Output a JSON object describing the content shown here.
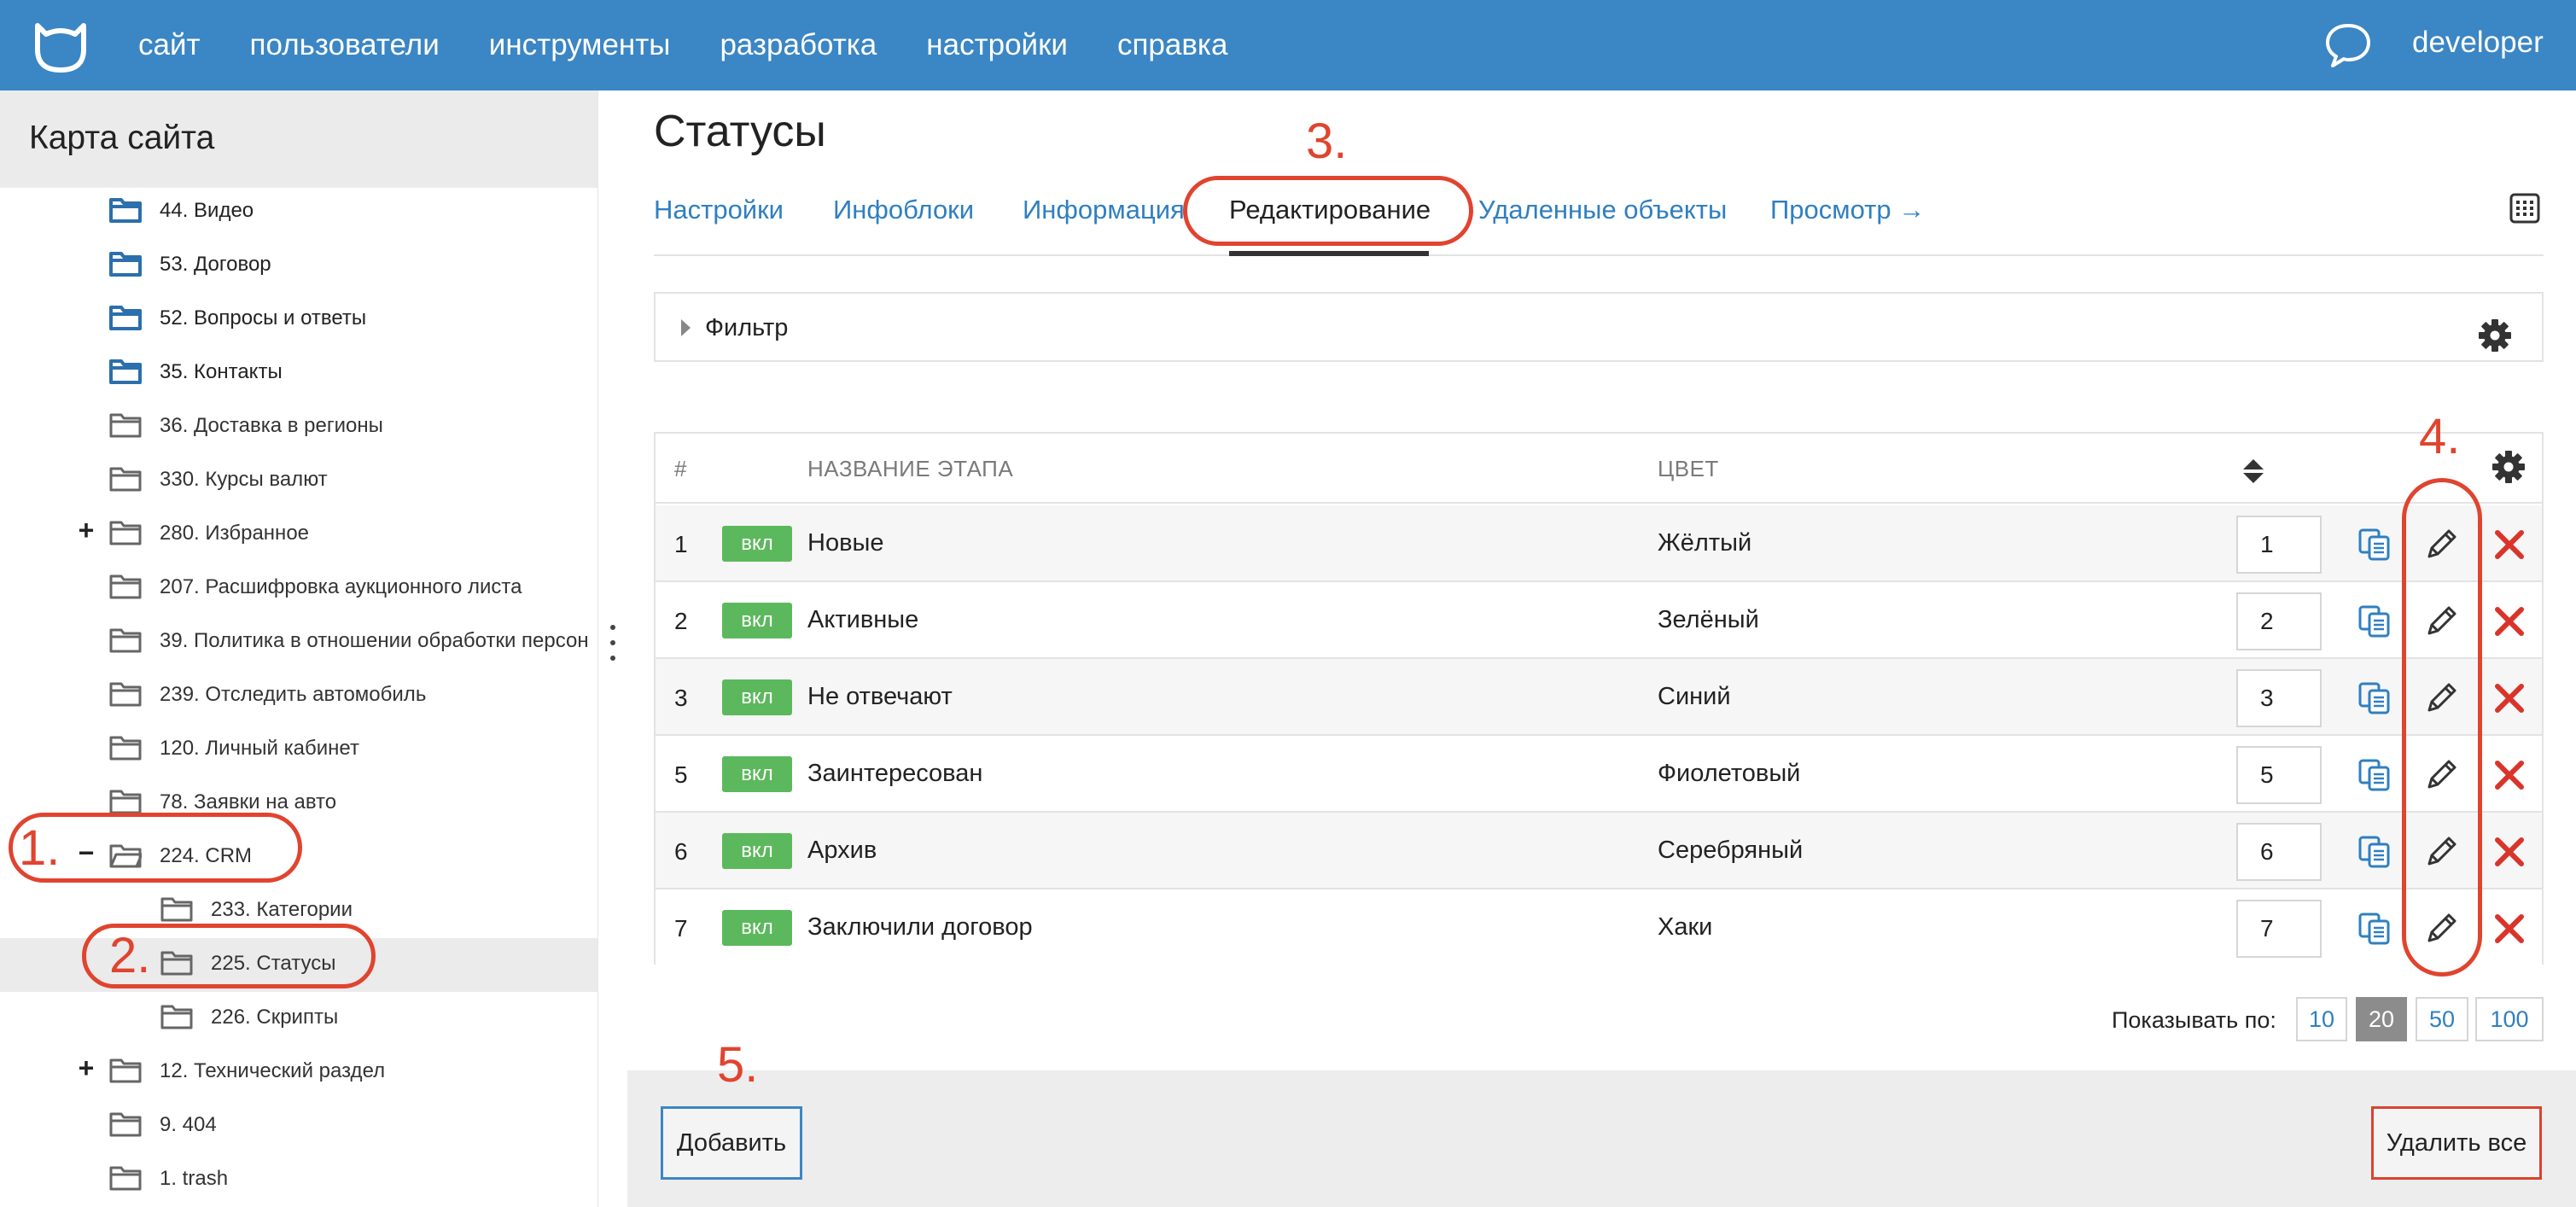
{
  "topbar": {
    "logo_icon": "cat-logo-icon",
    "nav": [
      "сайт",
      "пользователи",
      "инструменты",
      "разработка",
      "настройки",
      "справка"
    ],
    "chat_icon": "chat-bubble-icon",
    "user": "developer",
    "color": "#3b86c4"
  },
  "sidebar": {
    "title": "Карта сайта",
    "items": [
      {
        "label": "44. Видео",
        "toggle": ""
      },
      {
        "label": "53. Договор",
        "toggle": ""
      },
      {
        "label": "52. Вопросы и ответы",
        "toggle": ""
      },
      {
        "label": "35. Контакты",
        "toggle": ""
      },
      {
        "label": "36. Доставка в регионы",
        "toggle": ""
      },
      {
        "label": "330. Курсы валют",
        "toggle": ""
      },
      {
        "label": "280. Избранное",
        "toggle": "+"
      },
      {
        "label": "207. Расшифровка аукционного листа",
        "toggle": ""
      },
      {
        "label": "39. Политика в отношении обработки персон",
        "toggle": ""
      },
      {
        "label": "239. Отследить автомобиль",
        "toggle": ""
      },
      {
        "label": "120. Личный кабинет",
        "toggle": ""
      },
      {
        "label": "78. Заявки на авто",
        "toggle": ""
      },
      {
        "label": "224. CRM",
        "toggle": "−"
      },
      {
        "label": "233. Категории",
        "toggle": ""
      },
      {
        "label": "225. Статусы",
        "toggle": ""
      },
      {
        "label": "226. Скрипты",
        "toggle": ""
      },
      {
        "label": "12. Технический раздел",
        "toggle": "+"
      },
      {
        "label": "9. 404",
        "toggle": ""
      },
      {
        "label": "1. trash",
        "toggle": ""
      }
    ]
  },
  "page": {
    "title": "Статусы",
    "tabs": [
      "Настройки",
      "Инфоблоки",
      "Информация",
      "Редактирование",
      "Удаленные объекты",
      "Просмотр →"
    ],
    "active_tab": "Редактирование",
    "filter_label": "Фильтр"
  },
  "table": {
    "headers": {
      "num": "#",
      "name": "НАЗВАНИЕ ЭТАПА",
      "color": "ЦВЕТ"
    },
    "rows": [
      {
        "id": "1",
        "badge": "вкл",
        "name": "Новые",
        "color": "Жёлтый",
        "order": "1"
      },
      {
        "id": "2",
        "badge": "вкл",
        "name": "Активные",
        "color": "Зелёный",
        "order": "2"
      },
      {
        "id": "3",
        "badge": "вкл",
        "name": "Не отвечают",
        "color": "Синий",
        "order": "3"
      },
      {
        "id": "5",
        "badge": "вкл",
        "name": "Заинтересован",
        "color": "Фиолетовый",
        "order": "5"
      },
      {
        "id": "6",
        "badge": "вкл",
        "name": "Архив",
        "color": "Серебряный",
        "order": "6"
      },
      {
        "id": "7",
        "badge": "вкл",
        "name": "Заключили договор",
        "color": "Хаки",
        "order": "7"
      }
    ],
    "badge_color": "#5cb85c"
  },
  "pager": {
    "label": "Показывать по:",
    "options": [
      "10",
      "20",
      "50",
      "100"
    ],
    "selected": "20"
  },
  "footer": {
    "add": "Добавить",
    "delete_all": "Удалить все"
  },
  "annotations": {
    "n1": "1.",
    "n2": "2.",
    "n3": "3.",
    "n4": "4.",
    "n5": "5.",
    "color": "#e0442f"
  }
}
